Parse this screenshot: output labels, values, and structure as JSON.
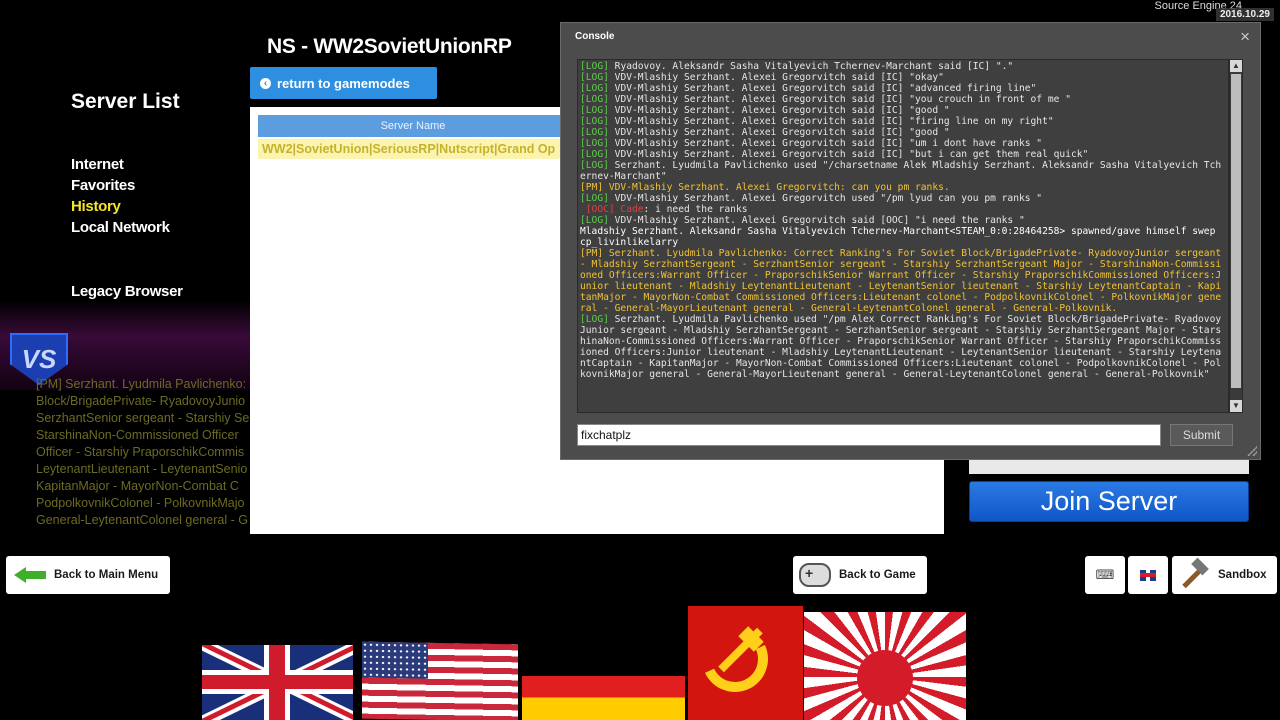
{
  "top": {
    "engine_label": "Source Engine 24",
    "date": "2016.10.29"
  },
  "nav": {
    "title": "Server List",
    "items": [
      {
        "label": "Internet"
      },
      {
        "label": "Favorites"
      },
      {
        "label": "History"
      },
      {
        "label": "Local Network"
      }
    ],
    "legacy": "Legacy Browser"
  },
  "gamemode": {
    "title": "NS - WW2SovietUnionRP",
    "return_label": "return to gamemodes"
  },
  "server_table": {
    "header": "Server Name",
    "rows": [
      {
        "name": "WW2|SovietUnion|SeriousRP|Nutscript|Grand Op"
      }
    ]
  },
  "background_text": [
    "[PM] Serzhant. Lyudmila Pavlichenko: C",
    "Block/BrigadePrivate- RyadovoyJunio",
    "SerzhantSenior sergeant - Starshiy Se",
    "StarshinaNon-Commissioned Officer",
    "Officer - Starshiy PraporschikCommis",
    "LeytenantLieutenant - LeytenantSenio",
    "KapitanMajor - MayorNon-Combat C",
    "PodpolkovnikColonel - PolkovnikMajo",
    "General-LeytenantColonel general - G"
  ],
  "join_label": "Join Server",
  "bottom": {
    "back_main": "Back to Main Menu",
    "back_game": "Back to Game",
    "sandbox": "Sandbox"
  },
  "console": {
    "title": "Console",
    "close": "×",
    "input_value": "fixchatplz",
    "submit": "Submit",
    "lines": [
      {
        "tag": "[LOG]",
        "type": "log",
        "text": " Ryadovoy. Aleksandr Sasha Vitalyevich Tchernev-Marchant said [IC] \".\""
      },
      {
        "tag": "[LOG]",
        "type": "log",
        "text": " VDV-Mlashiy Serzhant. Alexei Gregorvitch said [IC] \"okay\""
      },
      {
        "tag": "[LOG]",
        "type": "log",
        "text": " VDV-Mlashiy Serzhant. Alexei Gregorvitch said [IC] \"advanced firing line\""
      },
      {
        "tag": "[LOG]",
        "type": "log",
        "text": " VDV-Mlashiy Serzhant. Alexei Gregorvitch said [IC] \"you crouch in front of me \""
      },
      {
        "tag": "[LOG]",
        "type": "log",
        "text": " VDV-Mlashiy Serzhant. Alexei Gregorvitch said [IC] \"good \""
      },
      {
        "tag": "[LOG]",
        "type": "log",
        "text": " VDV-Mlashiy Serzhant. Alexei Gregorvitch said [IC] \"firing line on my right\""
      },
      {
        "tag": "[LOG]",
        "type": "log",
        "text": " VDV-Mlashiy Serzhant. Alexei Gregorvitch said [IC] \"good \""
      },
      {
        "tag": "[LOG]",
        "type": "log",
        "text": " VDV-Mlashiy Serzhant. Alexei Gregorvitch said [IC] \"um i dont have ranks \""
      },
      {
        "tag": "[LOG]",
        "type": "log",
        "text": " VDV-Mlashiy Serzhant. Alexei Gregorvitch said [IC] \"but i can get them real quick\""
      },
      {
        "tag": "[LOG]",
        "type": "log",
        "text": " Serzhant. Lyudmila Pavlichenko used \"/charsetname Alek Mladshiy Serzhant. Aleksandr Sasha Vitalyevich Tchernev-Marchant\""
      },
      {
        "tag": "[PM]",
        "type": "pm",
        "text": " VDV-Mlashiy Serzhant. Alexei Gregorvitch: can you pm ranks."
      },
      {
        "tag": "[LOG]",
        "type": "log",
        "text": " VDV-Mlashiy Serzhant. Alexei Gregorvitch used \"/pm lyud can you pm ranks \""
      },
      {
        "tag": " [OOC] Cade",
        "type": "ooc",
        "text": ": i need the ranks"
      },
      {
        "tag": "[LOG]",
        "type": "log",
        "text": " VDV-Mlashiy Serzhant. Alexei Gregorvitch said [OOC] \"i need the ranks \""
      },
      {
        "tag": "",
        "type": "white",
        "text": "Mladshiy Serzhant. Aleksandr Sasha Vitalyevich Tchernev-Marchant<STEAM_0:0:28464258> spawned/gave himself swep cp_livinlikelarry"
      },
      {
        "tag": "[PM]",
        "type": "pm",
        "text": " Serzhant. Lyudmila Pavlichenko: Correct Ranking's For Soviet Block/BrigadePrivate- RyadovoyJunior sergeant - Mladshiy SerzhantSergeant - SerzhantSenior sergeant - Starshiy SerzhantSergeant Major - StarshinaNon-Commissioned Officers:Warrant Officer - PraporschikSenior Warrant Officer - Starshiy PraporschikCommissioned Officers:Junior lieutenant - Mladshiy LeytenantLieutenant - LeytenantSenior lieutenant - Starshiy LeytenantCaptain - KapitanMajor - MayorNon-Combat Commissioned Officers:Lieutenant colonel - PodpolkovnikColonel - PolkovnikMajor general - General-MayorLieutenant general - General-LeytenantColonel general - General-Polkovnik."
      },
      {
        "tag": "[LOG]",
        "type": "log",
        "text": " Serzhant. Lyudmila Pavlichenko used \"/pm Alex Correct Ranking's For Soviet Block/BrigadePrivate- RyadovoyJunior sergeant - Mladshiy SerzhantSergeant - SerzhantSenior sergeant - Starshiy SerzhantSergeant Major - StarshinaNon-Commissioned Officers:Warrant Officer - PraporschikSenior Warrant Officer - Starshiy PraporschikCommissioned Officers:Junior lieutenant - Mladshiy LeytenantLieutenant - LeytenantSenior lieutenant - Starshiy LeytenantCaptain - KapitanMajor - MayorNon-Combat Commissioned Officers:Lieutenant colonel - PodpolkovnikColonel - PolkovnikMajor general - General-MayorLieutenant general - General-LeytenantColonel general - General-Polkovnik\""
      }
    ]
  },
  "colors": {
    "accent_blue": "#2e8fe0",
    "join_blue": "#1a66d6",
    "nav_active": "#f5e32c",
    "log_green": "#5dcf4a",
    "pm_yellow": "#f3c232",
    "ooc_red": "#e04040"
  },
  "icons": {
    "vs_logo": "VS",
    "flags": [
      "uk-flag",
      "us-flag",
      "germany-flag",
      "ussr-flag",
      "rising-sun-flag"
    ]
  }
}
